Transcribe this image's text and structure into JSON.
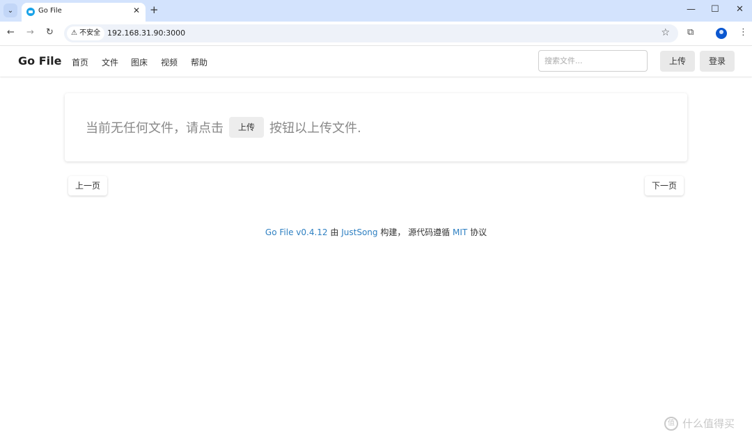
{
  "browser": {
    "tab_title": "Go File",
    "url": "192.168.31.90:3000",
    "insecure_label": "不安全"
  },
  "navbar": {
    "brand": "Go File",
    "items": [
      "首页",
      "文件",
      "图床",
      "视频",
      "帮助"
    ],
    "search_placeholder": "搜索文件...",
    "upload_label": "上传",
    "login_label": "登录"
  },
  "main": {
    "empty_text_before": "当前无任何文件，请点击",
    "upload_button": "上传",
    "empty_text_after": "按钮以上传文件."
  },
  "pagination": {
    "prev": "上一页",
    "next": "下一页"
  },
  "footer": {
    "app_link": "Go File v0.4.12",
    "by": "由",
    "author_link": "JustSong",
    "built_text": "构建，  源代码遵循",
    "license_link": "MIT",
    "license_suffix": "协议"
  },
  "watermark": {
    "text": "什么值得买",
    "badge": "值"
  }
}
